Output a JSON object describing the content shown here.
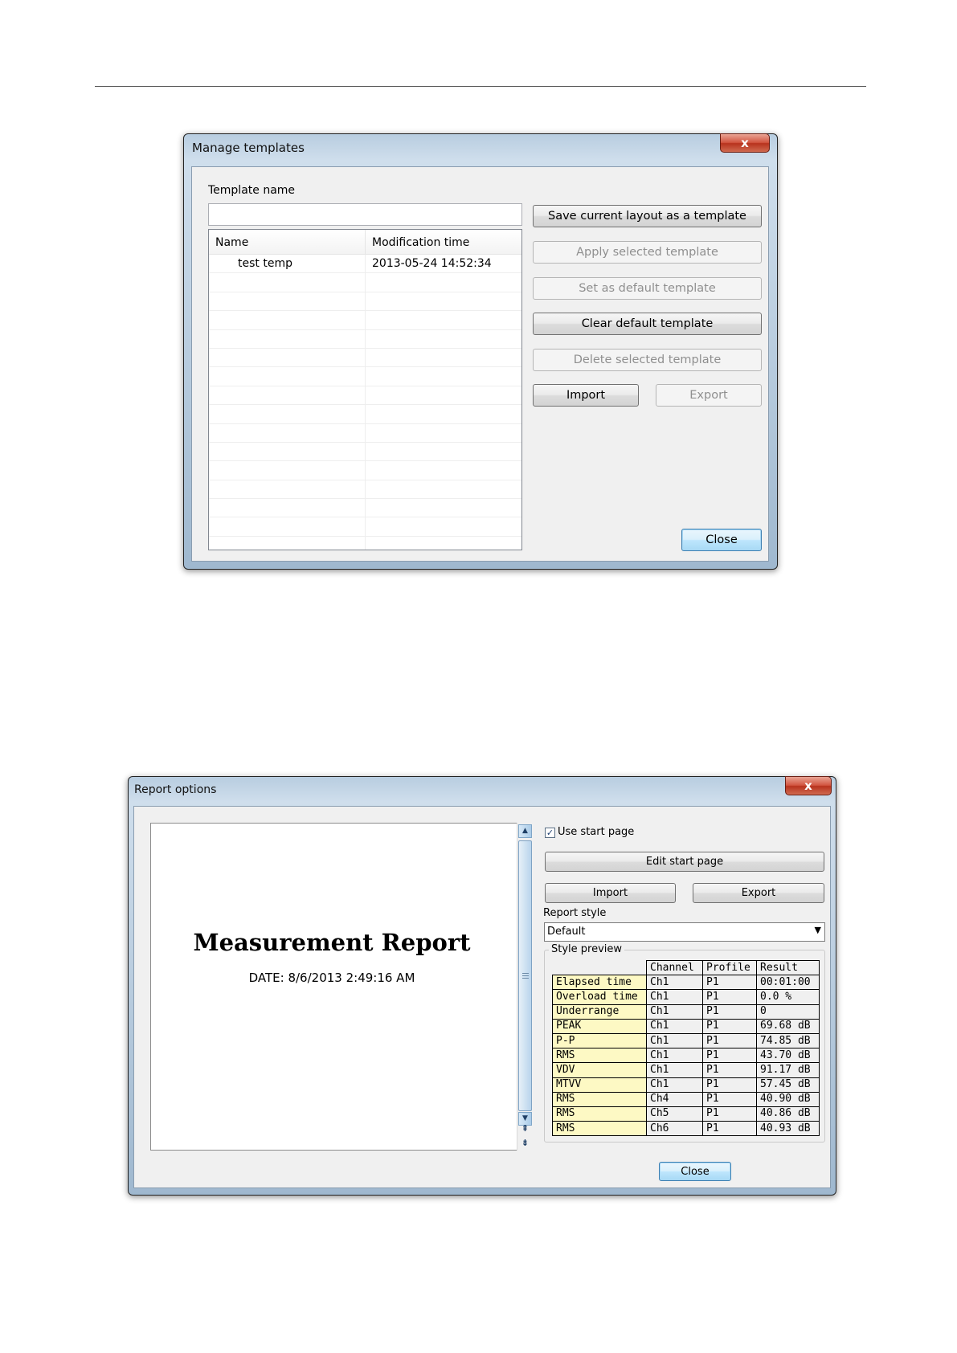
{
  "manage_templates": {
    "title": "Manage templates",
    "close_glyph": "x",
    "template_name_label": "Template name",
    "template_name_value": "",
    "columns": [
      "Name",
      "Modification time"
    ],
    "rows": [
      {
        "name": "test temp",
        "modified": "2013-05-24 14:52:34"
      }
    ],
    "buttons": {
      "save": "Save current layout as a template",
      "apply": "Apply selected template",
      "set_default": "Set as default template",
      "clear_default": "Clear default template",
      "delete": "Delete selected template",
      "import": "Import",
      "export": "Export",
      "close": "Close"
    }
  },
  "report_options": {
    "title": "Report options",
    "close_glyph": "x",
    "preview": {
      "report_title": "Measurement Report",
      "date": "DATE: 8/6/2013 2:49:16 AM"
    },
    "use_start_page": {
      "label": "Use start page",
      "checked": true,
      "check_glyph": "✓"
    },
    "buttons": {
      "edit_start_page": "Edit start page",
      "import": "Import",
      "export": "Export",
      "close": "Close"
    },
    "report_style_label": "Report style",
    "report_style_value": "Default",
    "style_preview_label": "Style preview",
    "style_table": {
      "header": [
        "",
        "Channel",
        "Profile",
        "Result"
      ],
      "rows": [
        [
          "Elapsed time",
          "Ch1",
          "P1",
          "00:01:00"
        ],
        [
          "Overload time",
          "Ch1",
          "P1",
          "0.0 %"
        ],
        [
          "Underrange",
          "Ch1",
          "P1",
          "0"
        ],
        [
          "PEAK",
          "Ch1",
          "P1",
          "69.68 dB"
        ],
        [
          "P-P",
          "Ch1",
          "P1",
          "74.85 dB"
        ],
        [
          "RMS",
          "Ch1",
          "P1",
          "43.70 dB"
        ],
        [
          "VDV",
          "Ch1",
          "P1",
          "91.17 dB"
        ],
        [
          "MTVV",
          "Ch1",
          "P1",
          "57.45 dB"
        ],
        [
          "RMS",
          "Ch4",
          "P1",
          "40.90 dB"
        ],
        [
          "RMS",
          "Ch5",
          "P1",
          "40.86 dB"
        ],
        [
          "RMS",
          "Ch6",
          "P1",
          "40.93 dB"
        ]
      ]
    }
  }
}
